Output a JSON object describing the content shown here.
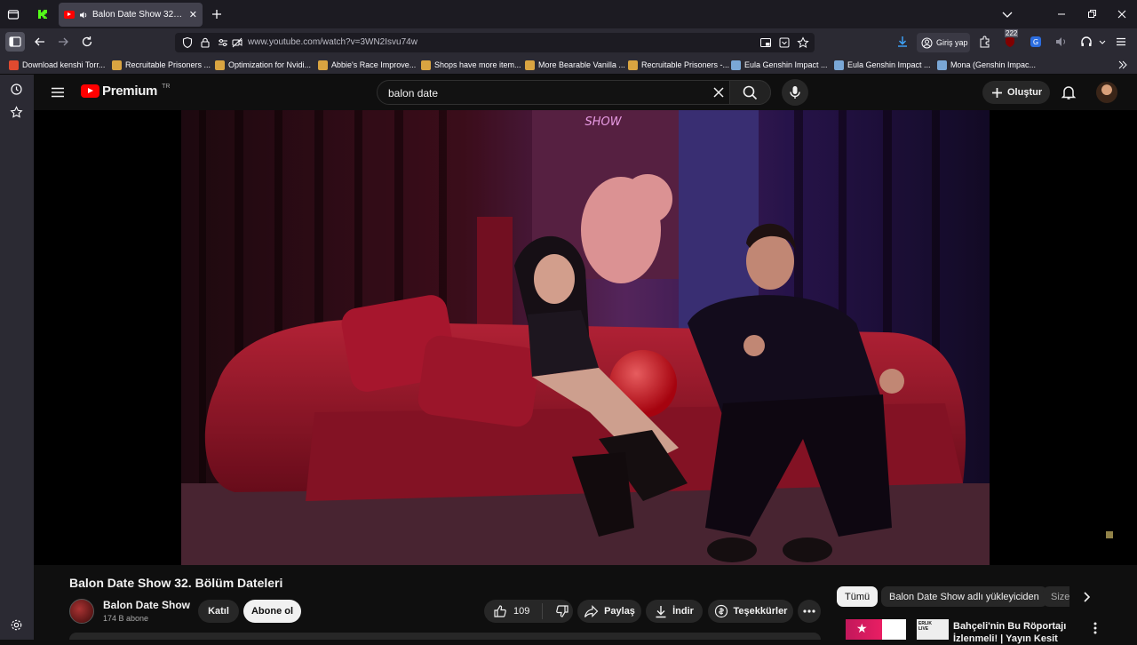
{
  "browser": {
    "tab_title": "Balon Date Show 32. Bölüm",
    "url": "www.youtube.com/watch?v=3WN2Isvu74w",
    "sign_in_label": "Giriş yap",
    "badge_count": "222",
    "bookmarks": [
      {
        "label": "Download kenshi Torr...",
        "color": "#e04a2f"
      },
      {
        "label": "Recruitable Prisoners ...",
        "color": "#d9a441"
      },
      {
        "label": "Optimization for Nvidi...",
        "color": "#d9a441"
      },
      {
        "label": "Abbie's Race Improve...",
        "color": "#d9a441"
      },
      {
        "label": "Shops have more item...",
        "color": "#d9a441"
      },
      {
        "label": "More Bearable Vanilla ...",
        "color": "#d9a441"
      },
      {
        "label": "Recruitable Prisoners -...",
        "color": "#d9a441"
      },
      {
        "label": "Eula Genshin Impact ...",
        "color": "#7aa7d6"
      },
      {
        "label": "Eula Genshin Impact ...",
        "color": "#7aa7d6"
      },
      {
        "label": "Mona (Genshin Impac...",
        "color": "#7aa7d6"
      }
    ]
  },
  "youtube": {
    "logo_text": "Premium",
    "region": "TR",
    "search_value": "balon date",
    "create_label": "Oluştur",
    "video": {
      "neon_sign": "SHOW",
      "title": "Balon Date Show 32. Bölüm Dateleri",
      "channel_name": "Balon Date Show",
      "subscribers": "174 B abone",
      "join_label": "Katıl",
      "subscribe_label": "Abone ol",
      "likes": "109",
      "share_label": "Paylaş",
      "download_label": "İndir",
      "thanks_label": "Teşekkürler"
    },
    "chips": [
      "Tümü",
      "Balon Date Show adlı yükleyiciden",
      "Size"
    ],
    "suggestion": {
      "thumb_badge": "ERLIK LIVE",
      "title_line1": "Bahçeli'nin Bu Röportajı",
      "title_line2": "İzlenmeli! | Yayın Kesit"
    }
  },
  "colors": {
    "yt_red": "#ff0000",
    "accent_blue": "#3ea6ff"
  }
}
